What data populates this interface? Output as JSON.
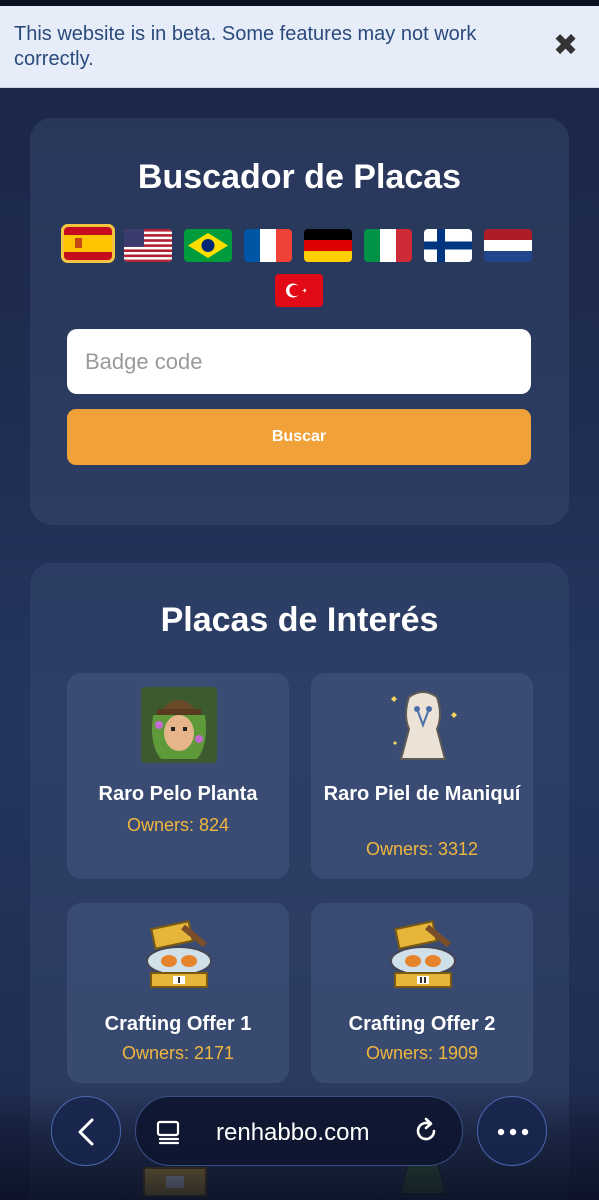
{
  "banner": {
    "text": "This website is in beta. Some features may not work correctly.",
    "close_glyph": "✖"
  },
  "search": {
    "title": "Buscador de Placas",
    "input_placeholder": "Badge code",
    "input_value": "",
    "button_label": "Buscar",
    "flags": [
      {
        "code": "es",
        "icon": "spain-flag-icon",
        "selected": true
      },
      {
        "code": "us",
        "icon": "usa-flag-icon",
        "selected": false
      },
      {
        "code": "br",
        "icon": "brazil-flag-icon",
        "selected": false
      },
      {
        "code": "fr",
        "icon": "france-flag-icon",
        "selected": false
      },
      {
        "code": "de",
        "icon": "germany-flag-icon",
        "selected": false
      },
      {
        "code": "it",
        "icon": "italy-flag-icon",
        "selected": false
      },
      {
        "code": "fi",
        "icon": "finland-flag-icon",
        "selected": false
      },
      {
        "code": "nl",
        "icon": "netherlands-flag-icon",
        "selected": false
      },
      {
        "code": "tr",
        "icon": "turkey-flag-icon",
        "selected": false
      }
    ]
  },
  "interest": {
    "title": "Placas de Interés",
    "badges": [
      {
        "name": "Raro Pelo Planta",
        "owners": "Owners: 824",
        "icon": "plant-hair-badge-icon"
      },
      {
        "name": "Raro Piel de Maniquí",
        "owners": "Owners: 3312",
        "icon": "mannequin-badge-icon"
      },
      {
        "name": "Crafting Offer 1",
        "owners": "Owners: 2171",
        "icon": "crafting-chest-1-badge-icon"
      },
      {
        "name": "Crafting Offer 2",
        "owners": "Owners: 1909",
        "icon": "crafting-chest-2-badge-icon"
      }
    ]
  },
  "browser": {
    "url": "renhabbo.com",
    "back_icon": "chevron-left-icon",
    "reader_icon": "reader-mode-icon",
    "reload_icon": "reload-icon",
    "more_icon": "more-dots-icon"
  },
  "colors": {
    "accent": "#f0a13a",
    "owners_text": "#f0b63e",
    "selected_flag_border": "#f5c542",
    "banner_bg": "#e7edf8",
    "banner_text": "#2a4a7c"
  }
}
